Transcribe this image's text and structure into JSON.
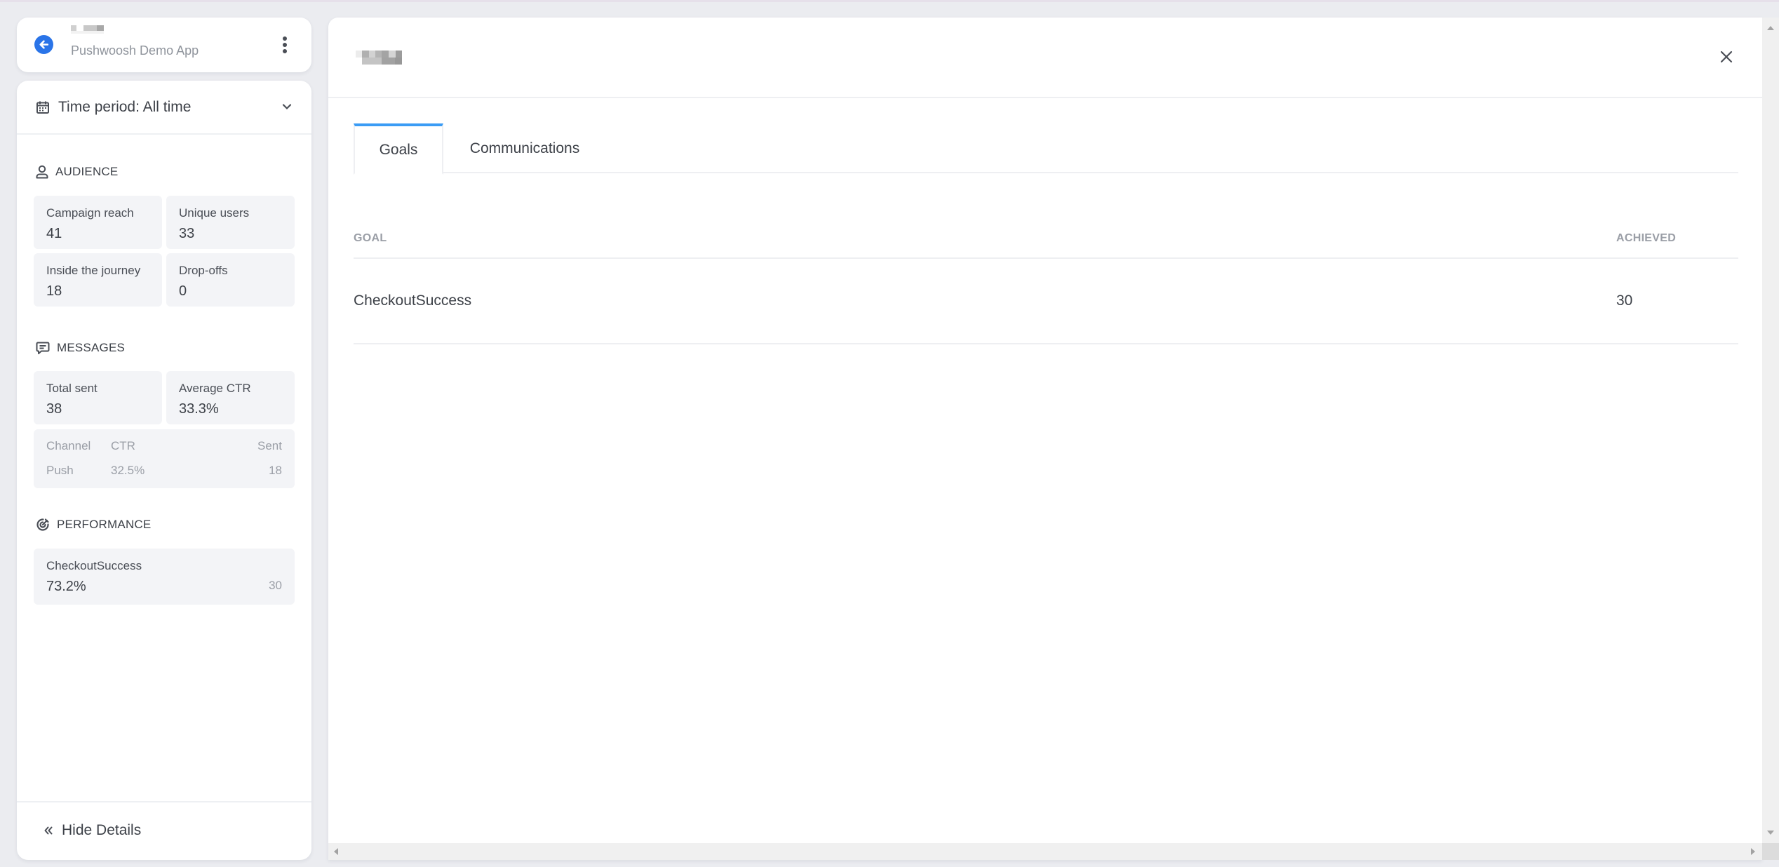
{
  "app": {
    "name": "Pushwoosh Demo App",
    "back_icon": "arrow-left-circle-icon",
    "more_icon": "more-vertical-icon"
  },
  "sidebar": {
    "time_period": {
      "label": "Time period: All time",
      "icon": "calendar-icon",
      "chevron_icon": "chevron-down-icon"
    },
    "audience": {
      "title": "AUDIENCE",
      "icon": "user-icon",
      "tiles": [
        {
          "label": "Campaign reach",
          "value": "41"
        },
        {
          "label": "Unique users",
          "value": "33"
        },
        {
          "label": "Inside the journey",
          "value": "18"
        },
        {
          "label": "Drop-offs",
          "value": "0"
        }
      ]
    },
    "messages": {
      "title": "MESSAGES",
      "icon": "message-icon",
      "tiles": [
        {
          "label": "Total sent",
          "value": "38"
        },
        {
          "label": "Average CTR",
          "value": "33.3%"
        }
      ],
      "channels": {
        "headers": [
          "Channel",
          "CTR",
          "Sent"
        ],
        "rows": [
          {
            "channel": "Push",
            "ctr": "32.5%",
            "sent": "18"
          }
        ]
      }
    },
    "performance": {
      "title": "PERFORMANCE",
      "icon": "target-icon",
      "goals": [
        {
          "name": "CheckoutSuccess",
          "rate": "73.2%",
          "count": "30"
        }
      ]
    },
    "hide_details": {
      "label": "Hide Details",
      "icon": "chevrons-left-icon"
    }
  },
  "panel": {
    "close_icon": "close-icon",
    "tabs": [
      {
        "label": "Goals",
        "active": true
      },
      {
        "label": "Communications",
        "active": false
      }
    ],
    "table": {
      "headers": [
        "GOAL",
        "ACHIEVED"
      ],
      "rows": [
        {
          "goal": "CheckoutSuccess",
          "achieved": "30"
        }
      ]
    }
  },
  "colors": {
    "accent": "#2a74e8",
    "tab_indicator": "#3b9cf5",
    "background": "#ebecf0",
    "tile_background": "#f3f4f7"
  }
}
